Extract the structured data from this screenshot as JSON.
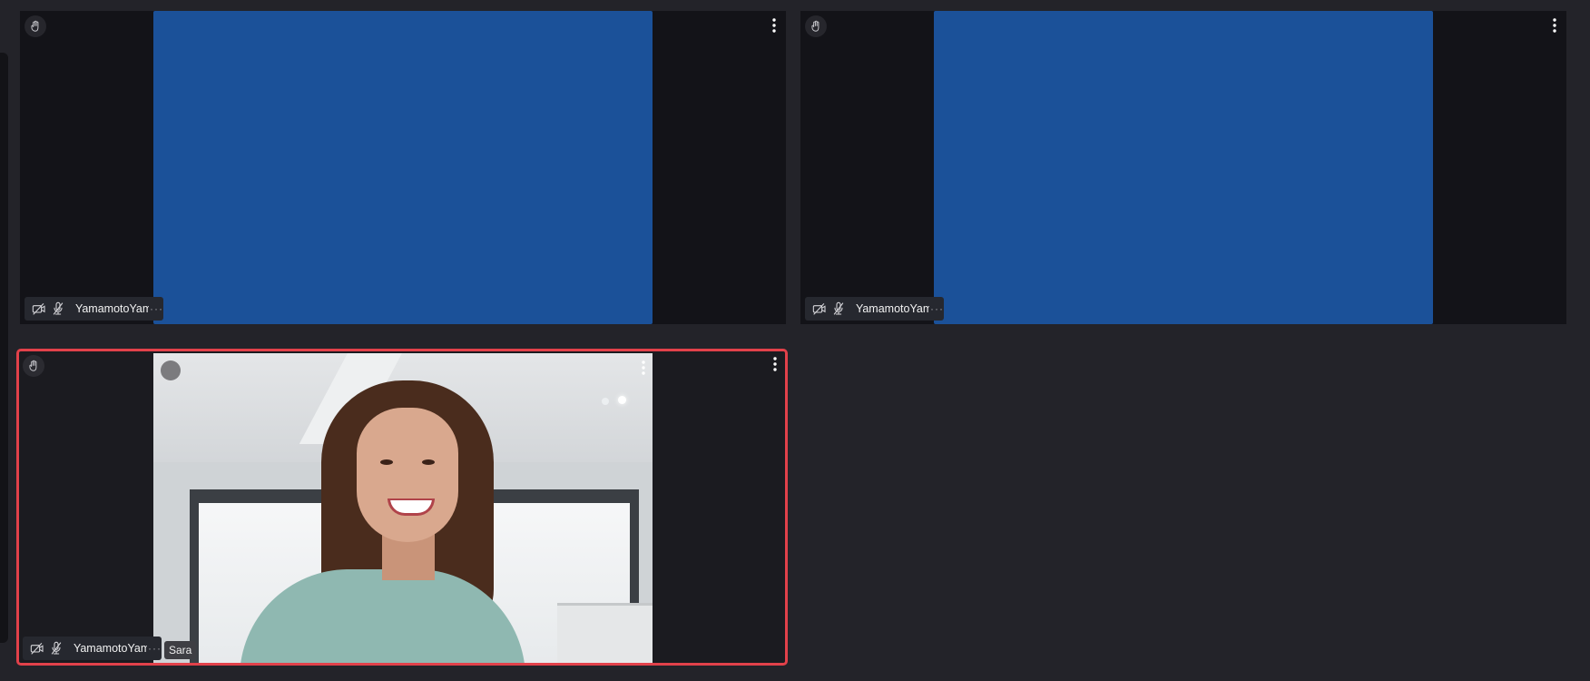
{
  "tiles": [
    {
      "participant_name": "YamamotoYam",
      "overflow": "···",
      "video": "camera-off-blue",
      "video_color": "#1b5199"
    },
    {
      "participant_name": "YamamotoYam",
      "overflow": "···",
      "video": "camera-off-blue",
      "video_color": "#1b5199"
    },
    {
      "participant_name": "YamamotoYam",
      "overflow": "···",
      "self_label": "Sara",
      "video": "camera-feed",
      "highlight_color": "#e2414a"
    }
  ],
  "icons": {
    "hand": "raise-hand-icon",
    "more": "more-vertical-icon",
    "camera": "camera-off-icon",
    "mic": "mic-off-icon"
  },
  "colors": {
    "background": "#232329",
    "tile": "#131318",
    "active_border": "#e2414a"
  }
}
